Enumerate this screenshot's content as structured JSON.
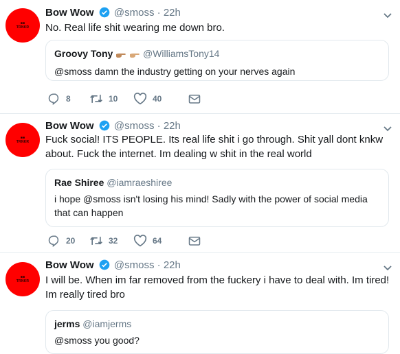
{
  "tweets": [
    {
      "name": "Bow Wow",
      "handle": "@smoss",
      "sep": "·",
      "time": "22h",
      "text": "No. Real life shit wearing me down bro.",
      "quote": {
        "name": "Groovy Tony",
        "handle": "@WilliamsTony14",
        "text": "@smoss damn the industry getting on your nerves again",
        "emoji": [
          "pointing-hand-emoji",
          "pointing-hand-emoji"
        ]
      },
      "replies": "8",
      "retweets": "10",
      "likes": "40"
    },
    {
      "name": "Bow Wow",
      "handle": "@smoss",
      "sep": "·",
      "time": "22h",
      "text": "Fuck social! ITS PEOPLE. Its real life shit i go through. Shit yall dont knkw about. Fuck the internet. Im dealing w shit in the real world",
      "quote": {
        "name": "Rae Shiree",
        "handle": "@iamraeshiree",
        "text": "i hope @smoss  isn't losing his mind! Sadly with the power of social media that can happen"
      },
      "replies": "20",
      "retweets": "32",
      "likes": "64"
    },
    {
      "name": "Bow Wow",
      "handle": "@smoss",
      "sep": "·",
      "time": "22h",
      "text": "I will be. When im far removed from the fuckery i have to deal with. Im tired! Im really tired bro",
      "quote": {
        "name": "jerms",
        "handle": "@iamjerms",
        "text": "@smoss you good?"
      }
    }
  ],
  "colors": {
    "avatar": "#ff0000",
    "verified": "#1da1f2",
    "muted": "#657786",
    "border": "#e1e8ed"
  },
  "icons": [
    "reply-icon",
    "retweet-icon",
    "like-icon",
    "direct-message-icon",
    "verified-badge-icon",
    "chevron-down-icon"
  ]
}
